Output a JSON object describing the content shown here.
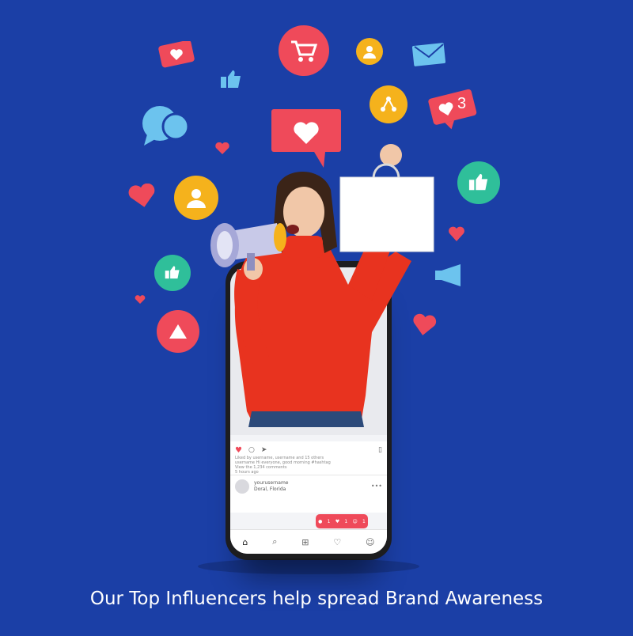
{
  "caption": "Our Top Influencers help spread Brand Awareness",
  "phone_post": {
    "liked_by": "Liked by username, username and 15 others",
    "post_text": "username Hi everyone, good morning #hashtag",
    "view_comments": "View the 1,234 comments",
    "time": "5 hours ago",
    "user_name": "yourusername",
    "user_location": "Doral, Florida"
  },
  "notification_counts": {
    "comments": "1",
    "likes": "1",
    "followers": "1"
  },
  "floating_badge_count": "3",
  "icons": [
    "heart-icon",
    "cart-icon",
    "user-icon",
    "mail-icon",
    "thumbs-up-icon",
    "chat-icon",
    "share-icon",
    "play-icon",
    "megaphone-icon",
    "shopping-bag-icon"
  ],
  "colors": {
    "background": "#1b3fa6",
    "accent_red": "#ef4a5a",
    "accent_yellow": "#f5b21c",
    "accent_teal": "#2fbf9a",
    "accent_lightblue": "#6cc3ee"
  }
}
